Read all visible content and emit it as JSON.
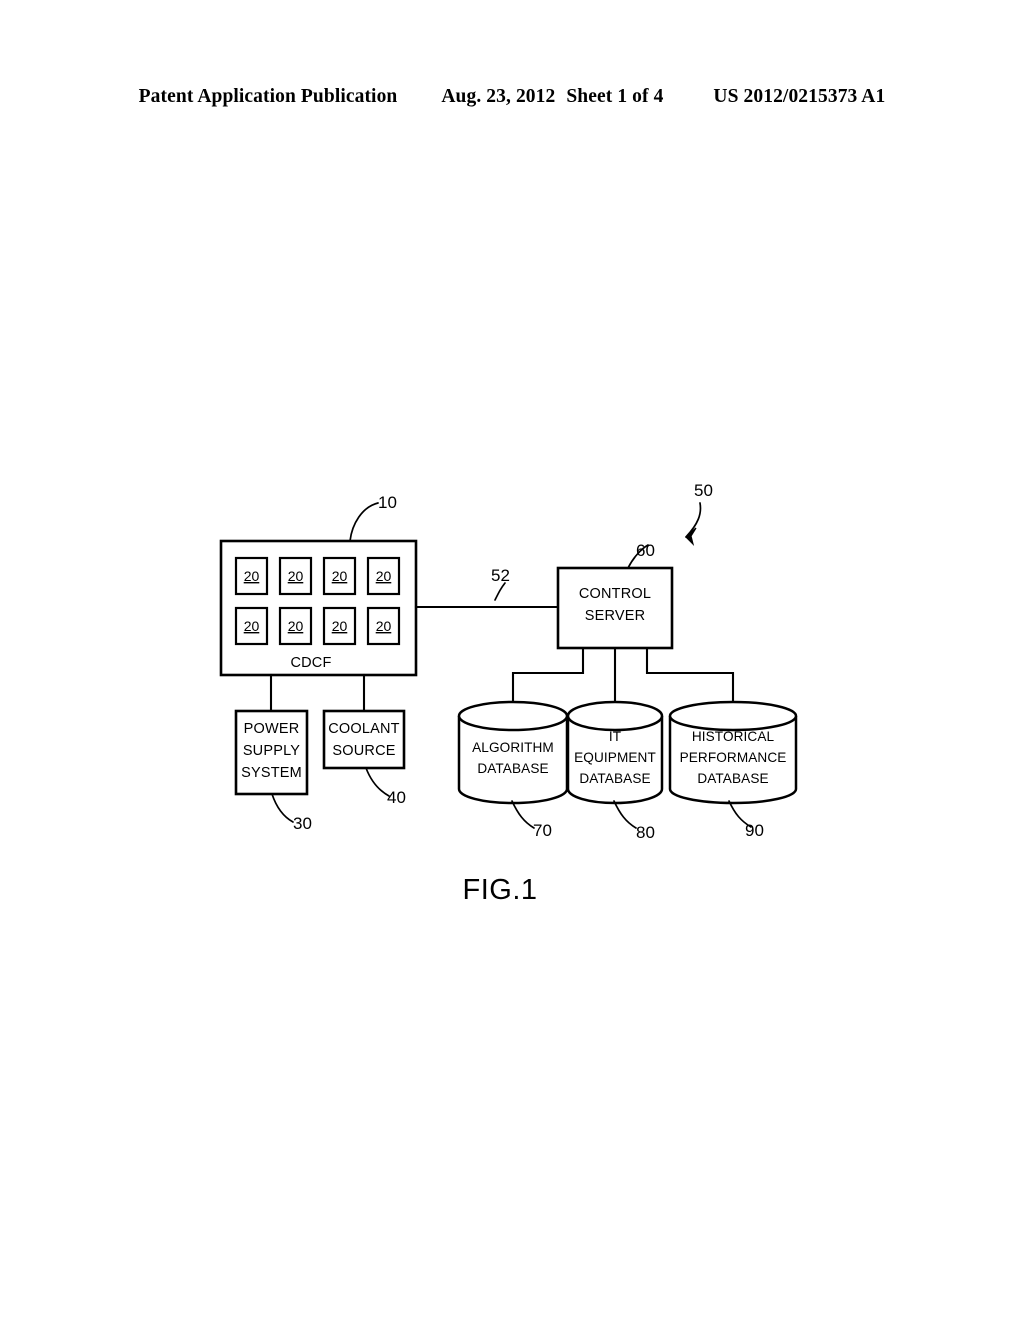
{
  "header": {
    "publication": "Patent Application Publication",
    "date": "Aug. 23, 2012",
    "sheet": "Sheet 1 of 4",
    "patent_number": "US 2012/0215373 A1"
  },
  "figure": {
    "caption": "FIG.1",
    "system_ref": "50",
    "nodes": {
      "cdcf": {
        "label": "CDCF",
        "ref": "10",
        "rack_label": "20",
        "rack_count": 8
      },
      "control_server": {
        "line1": "CONTROL",
        "line2": "SERVER",
        "ref": "60"
      },
      "power_supply": {
        "line1": "POWER",
        "line2": "SUPPLY",
        "line3": "SYSTEM",
        "ref": "30"
      },
      "coolant_source": {
        "line1": "COOLANT",
        "line2": "SOURCE",
        "ref": "40"
      },
      "algorithm_db": {
        "line1": "ALGORITHM",
        "line2": "DATABASE",
        "ref": "70"
      },
      "it_equipment_db": {
        "line1": "IT",
        "line2": "EQUIPMENT",
        "line3": "DATABASE",
        "ref": "80"
      },
      "historical_db": {
        "line1": "HISTORICAL",
        "line2": "PERFORMANCE",
        "line3": "DATABASE",
        "ref": "90"
      }
    },
    "connections": {
      "network_link_ref": "52"
    }
  }
}
